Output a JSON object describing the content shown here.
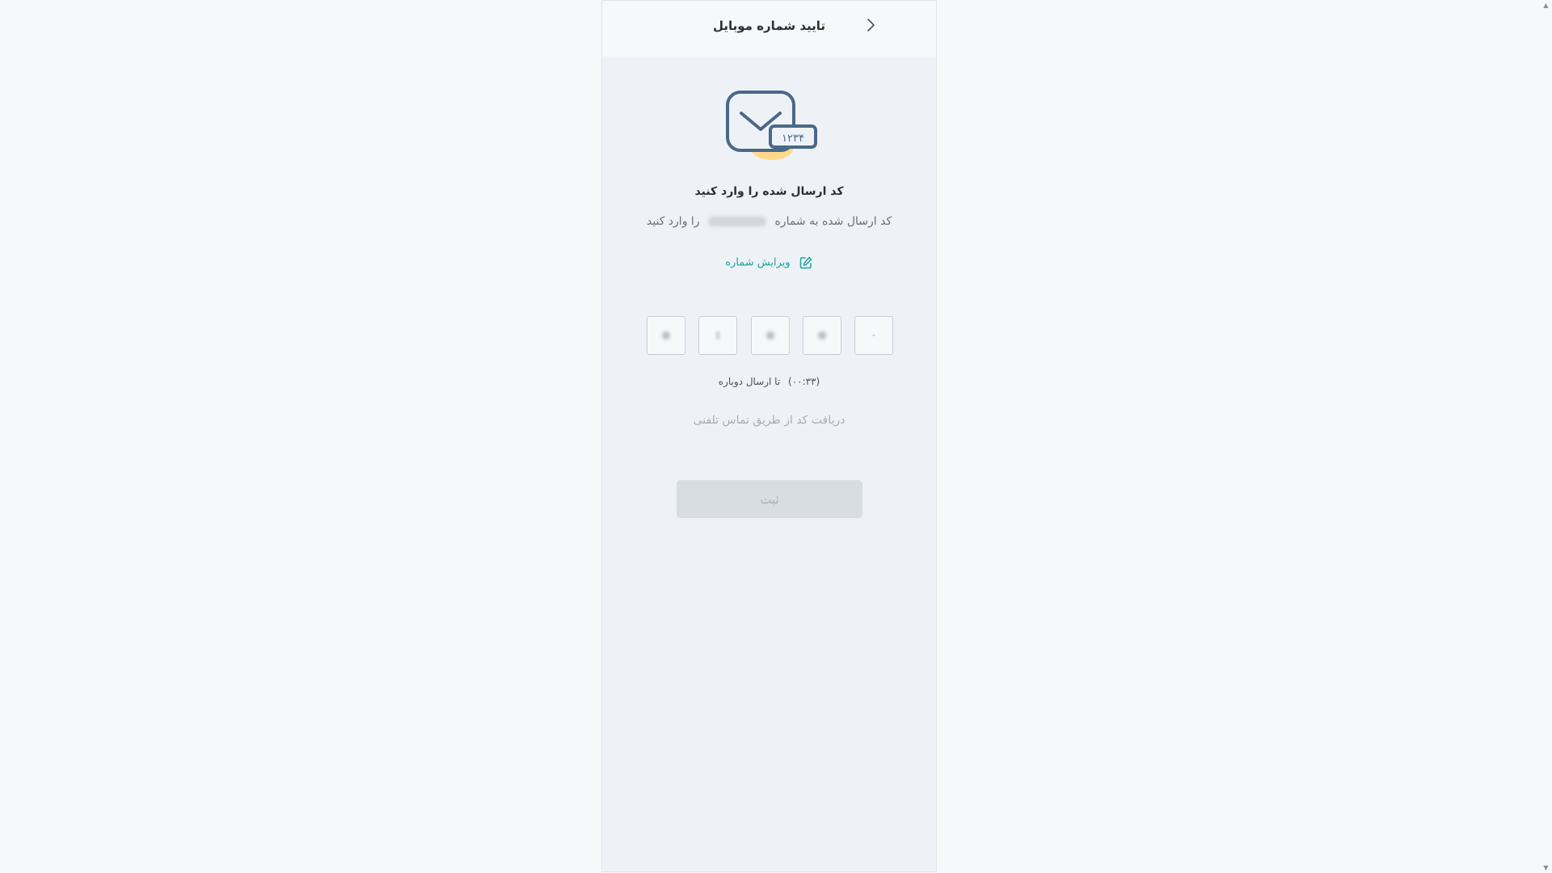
{
  "header": {
    "title": "تایید شماره موبایل",
    "back_icon": "chevron-right-icon"
  },
  "hero": {
    "icon": "envelope-code-icon",
    "code_digits": "۱۲۳۴",
    "colors": {
      "stroke": "#4a6889",
      "accent": "#ffd98a"
    }
  },
  "verify": {
    "headline": "کد ارسال شده را وارد کنید",
    "subline_prefix": "کد ارسال شده به شماره",
    "subline_suffix": "را وارد کنید",
    "edit_label": "ویرایش شماره",
    "edit_icon": "edit-icon",
    "edit_color": "#1aa39b"
  },
  "otp": {
    "boxes": [
      {
        "value": "-"
      },
      {
        "value": ""
      },
      {
        "value": ""
      },
      {
        "value": ""
      },
      {
        "value": ""
      }
    ]
  },
  "resend": {
    "timer": "(۰۰:۳۳)",
    "label": "تا ارسال دوباره"
  },
  "call_link": {
    "label": "دریافت کد از طریق تماس تلفنی"
  },
  "submit": {
    "label": "ثبت"
  }
}
